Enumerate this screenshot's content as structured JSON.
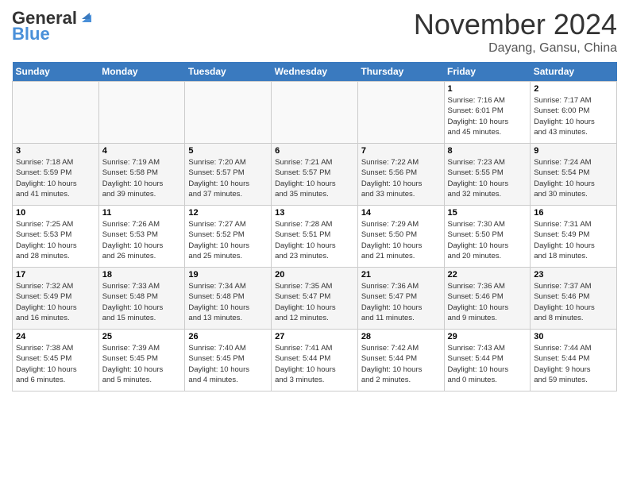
{
  "header": {
    "logo_general": "General",
    "logo_blue": "Blue",
    "month": "November 2024",
    "location": "Dayang, Gansu, China"
  },
  "days_of_week": [
    "Sunday",
    "Monday",
    "Tuesday",
    "Wednesday",
    "Thursday",
    "Friday",
    "Saturday"
  ],
  "weeks": [
    [
      {
        "day": "",
        "info": ""
      },
      {
        "day": "",
        "info": ""
      },
      {
        "day": "",
        "info": ""
      },
      {
        "day": "",
        "info": ""
      },
      {
        "day": "",
        "info": ""
      },
      {
        "day": "1",
        "info": "Sunrise: 7:16 AM\nSunset: 6:01 PM\nDaylight: 10 hours\nand 45 minutes."
      },
      {
        "day": "2",
        "info": "Sunrise: 7:17 AM\nSunset: 6:00 PM\nDaylight: 10 hours\nand 43 minutes."
      }
    ],
    [
      {
        "day": "3",
        "info": "Sunrise: 7:18 AM\nSunset: 5:59 PM\nDaylight: 10 hours\nand 41 minutes."
      },
      {
        "day": "4",
        "info": "Sunrise: 7:19 AM\nSunset: 5:58 PM\nDaylight: 10 hours\nand 39 minutes."
      },
      {
        "day": "5",
        "info": "Sunrise: 7:20 AM\nSunset: 5:57 PM\nDaylight: 10 hours\nand 37 minutes."
      },
      {
        "day": "6",
        "info": "Sunrise: 7:21 AM\nSunset: 5:57 PM\nDaylight: 10 hours\nand 35 minutes."
      },
      {
        "day": "7",
        "info": "Sunrise: 7:22 AM\nSunset: 5:56 PM\nDaylight: 10 hours\nand 33 minutes."
      },
      {
        "day": "8",
        "info": "Sunrise: 7:23 AM\nSunset: 5:55 PM\nDaylight: 10 hours\nand 32 minutes."
      },
      {
        "day": "9",
        "info": "Sunrise: 7:24 AM\nSunset: 5:54 PM\nDaylight: 10 hours\nand 30 minutes."
      }
    ],
    [
      {
        "day": "10",
        "info": "Sunrise: 7:25 AM\nSunset: 5:53 PM\nDaylight: 10 hours\nand 28 minutes."
      },
      {
        "day": "11",
        "info": "Sunrise: 7:26 AM\nSunset: 5:53 PM\nDaylight: 10 hours\nand 26 minutes."
      },
      {
        "day": "12",
        "info": "Sunrise: 7:27 AM\nSunset: 5:52 PM\nDaylight: 10 hours\nand 25 minutes."
      },
      {
        "day": "13",
        "info": "Sunrise: 7:28 AM\nSunset: 5:51 PM\nDaylight: 10 hours\nand 23 minutes."
      },
      {
        "day": "14",
        "info": "Sunrise: 7:29 AM\nSunset: 5:50 PM\nDaylight: 10 hours\nand 21 minutes."
      },
      {
        "day": "15",
        "info": "Sunrise: 7:30 AM\nSunset: 5:50 PM\nDaylight: 10 hours\nand 20 minutes."
      },
      {
        "day": "16",
        "info": "Sunrise: 7:31 AM\nSunset: 5:49 PM\nDaylight: 10 hours\nand 18 minutes."
      }
    ],
    [
      {
        "day": "17",
        "info": "Sunrise: 7:32 AM\nSunset: 5:49 PM\nDaylight: 10 hours\nand 16 minutes."
      },
      {
        "day": "18",
        "info": "Sunrise: 7:33 AM\nSunset: 5:48 PM\nDaylight: 10 hours\nand 15 minutes."
      },
      {
        "day": "19",
        "info": "Sunrise: 7:34 AM\nSunset: 5:48 PM\nDaylight: 10 hours\nand 13 minutes."
      },
      {
        "day": "20",
        "info": "Sunrise: 7:35 AM\nSunset: 5:47 PM\nDaylight: 10 hours\nand 12 minutes."
      },
      {
        "day": "21",
        "info": "Sunrise: 7:36 AM\nSunset: 5:47 PM\nDaylight: 10 hours\nand 11 minutes."
      },
      {
        "day": "22",
        "info": "Sunrise: 7:36 AM\nSunset: 5:46 PM\nDaylight: 10 hours\nand 9 minutes."
      },
      {
        "day": "23",
        "info": "Sunrise: 7:37 AM\nSunset: 5:46 PM\nDaylight: 10 hours\nand 8 minutes."
      }
    ],
    [
      {
        "day": "24",
        "info": "Sunrise: 7:38 AM\nSunset: 5:45 PM\nDaylight: 10 hours\nand 6 minutes."
      },
      {
        "day": "25",
        "info": "Sunrise: 7:39 AM\nSunset: 5:45 PM\nDaylight: 10 hours\nand 5 minutes."
      },
      {
        "day": "26",
        "info": "Sunrise: 7:40 AM\nSunset: 5:45 PM\nDaylight: 10 hours\nand 4 minutes."
      },
      {
        "day": "27",
        "info": "Sunrise: 7:41 AM\nSunset: 5:44 PM\nDaylight: 10 hours\nand 3 minutes."
      },
      {
        "day": "28",
        "info": "Sunrise: 7:42 AM\nSunset: 5:44 PM\nDaylight: 10 hours\nand 2 minutes."
      },
      {
        "day": "29",
        "info": "Sunrise: 7:43 AM\nSunset: 5:44 PM\nDaylight: 10 hours\nand 0 minutes."
      },
      {
        "day": "30",
        "info": "Sunrise: 7:44 AM\nSunset: 5:44 PM\nDaylight: 9 hours\nand 59 minutes."
      }
    ]
  ]
}
